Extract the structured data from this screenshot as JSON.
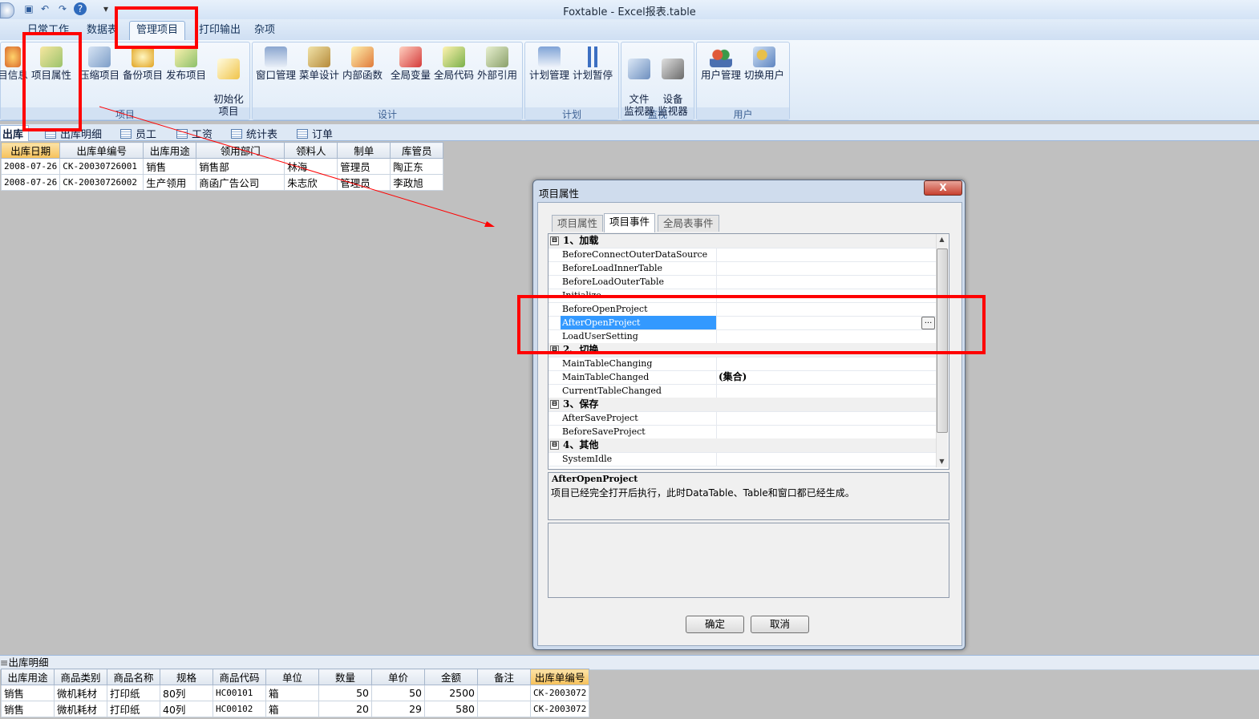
{
  "app": {
    "title": "Foxtable - Excel报表.table"
  },
  "qat": {
    "more": "▾"
  },
  "ribbon": {
    "tabs": [
      "日常工作",
      "数据表",
      "管理项目",
      "打印输出",
      "杂项"
    ],
    "active_tab": "管理项目",
    "groups": {
      "project": {
        "label": "项目",
        "buttons": [
          "目信息",
          "项目属性",
          "压缩项目",
          "备份项目",
          "发布项目",
          "初始化\n项目"
        ]
      },
      "design": {
        "label": "设计",
        "buttons": [
          "窗口管理",
          "菜单设计",
          "内部函数",
          "全局变量",
          "全局代码",
          "外部引用"
        ]
      },
      "plan": {
        "label": "计划",
        "buttons": [
          "计划管理",
          "计划暂停"
        ]
      },
      "monitor": {
        "label": "监视",
        "buttons": [
          "文件\n监视器",
          "设备\n监视器"
        ]
      },
      "user": {
        "label": "用户",
        "buttons": [
          "用户管理",
          "切换用户"
        ]
      }
    }
  },
  "sheet_tabs": [
    "出库",
    "出库明细",
    "员工",
    "工资",
    "统计表",
    "订单"
  ],
  "top_table": {
    "headers": [
      "出库日期",
      "出库单编号",
      "出库用途",
      "领用部门",
      "领料人",
      "制单",
      "库管员"
    ],
    "rows": [
      [
        "2008-07-26",
        "CK-20030726001",
        "销售",
        "销售部",
        "林海",
        "管理员",
        "陶正东"
      ],
      [
        "2008-07-26",
        "CK-20030726002",
        "生产领用",
        "商函广告公司",
        "朱志欣",
        "管理员",
        "李政旭"
      ]
    ]
  },
  "dialog": {
    "title": "项目属性",
    "close": "X",
    "tabs": [
      "项目属性",
      "项目事件",
      "全局表事件"
    ],
    "active_tab": "项目事件",
    "rows": [
      {
        "type": "cat",
        "mark": "⊟",
        "name": "1、加载"
      },
      {
        "type": "item",
        "name": "BeforeConnectOuterDataSource",
        "value": ""
      },
      {
        "type": "item",
        "name": "BeforeLoadInnerTable",
        "value": ""
      },
      {
        "type": "item",
        "name": "BeforeLoadOuterTable",
        "value": ""
      },
      {
        "type": "item",
        "name": "Initialize",
        "value": ""
      },
      {
        "type": "item",
        "name": "BeforeOpenProject",
        "value": ""
      },
      {
        "type": "item",
        "name": "AfterOpenProject",
        "value": "",
        "selected": true
      },
      {
        "type": "item",
        "name": "LoadUserSetting",
        "value": ""
      },
      {
        "type": "cat",
        "mark": "⊟",
        "name": "2、切换"
      },
      {
        "type": "item",
        "name": "MainTableChanging",
        "value": ""
      },
      {
        "type": "item",
        "name": "MainTableChanged",
        "value": "(集合)"
      },
      {
        "type": "item",
        "name": "CurrentTableChanged",
        "value": ""
      },
      {
        "type": "cat",
        "mark": "⊟",
        "name": "3、保存"
      },
      {
        "type": "item",
        "name": "AfterSaveProject",
        "value": ""
      },
      {
        "type": "item",
        "name": "BeforeSaveProject",
        "value": ""
      },
      {
        "type": "cat",
        "mark": "⊟",
        "name": "4、其他"
      },
      {
        "type": "item",
        "name": "SystemIdle",
        "value": ""
      }
    ],
    "ellipsis": "...",
    "desc_title": "AfterOpenProject",
    "desc_text": "项目已经完全打开后执行，此时DataTable、Table和窗口都已经生成。",
    "ok": "确定",
    "cancel": "取消"
  },
  "bottom": {
    "title": "出库明细",
    "headers": [
      "出库用途",
      "商品类别",
      "商品名称",
      "规格",
      "商品代码",
      "单位",
      "数量",
      "单价",
      "金额",
      "备注",
      "出库单编号"
    ],
    "rows": [
      [
        "销售",
        "微机耗材",
        "打印纸",
        "80列",
        "HC00101",
        "箱",
        "50",
        "50",
        "2500",
        "",
        "CK-2003072"
      ],
      [
        "销售",
        "微机耗材",
        "打印纸",
        "40列",
        "HC00102",
        "箱",
        "20",
        "29",
        "580",
        "",
        "CK-2003072"
      ]
    ]
  },
  "colors": {
    "highlight": "#ff0000",
    "selection": "#3399ff",
    "ribbon": "#dbe8f6"
  }
}
